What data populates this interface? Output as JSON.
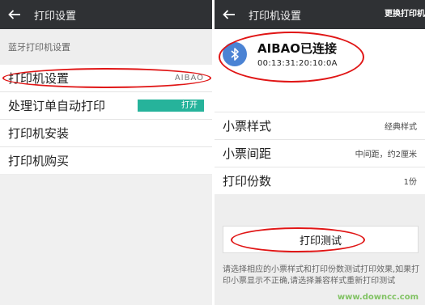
{
  "left": {
    "header": {
      "title": "打印设置"
    },
    "section_title": "蓝牙打印机设置",
    "rows": [
      {
        "label": "打印机设置",
        "value": "AIBAO"
      },
      {
        "label": "处理订单自动打印",
        "toggle": "打开"
      },
      {
        "label": "打印机安装"
      },
      {
        "label": "打印机购买"
      }
    ]
  },
  "right": {
    "header": {
      "title": "打印机设置",
      "action": "更换打印机"
    },
    "device": {
      "name": "AIBAO已连接",
      "mac": "00:13:31:20:10:0A",
      "icon": "bluetooth-icon"
    },
    "settings": [
      {
        "label": "小票样式",
        "value": "经典样式"
      },
      {
        "label": "小票间距",
        "value": "中间距，约2厘米"
      },
      {
        "label": "打印份数",
        "value": "1份"
      }
    ],
    "test_button": "打印测试",
    "hint": "请选择相应的小票样式和打印份数测试打印效果,如果打印小票显示不正确,请选择兼容样式重新打印测试"
  },
  "watermark": "www.downcc.com",
  "colors": {
    "appbar": "#2f3134",
    "toggle": "#26b39b",
    "bluetooth": "#4b83d4",
    "annotation": "#e01515"
  }
}
